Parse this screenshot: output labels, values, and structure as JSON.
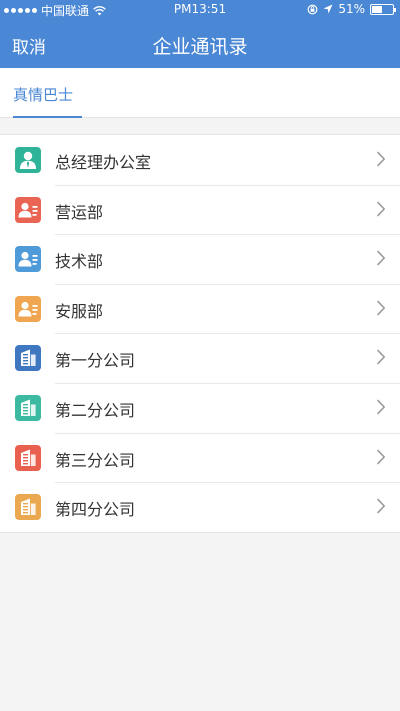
{
  "status": {
    "carrier": "中国联通",
    "time": "PM13:51",
    "battery": "51%",
    "battery_level": 0.51
  },
  "nav": {
    "cancel": "取消",
    "title": "企业通讯录"
  },
  "tabs": [
    {
      "label": "真情巴士"
    }
  ],
  "list": [
    {
      "label": "总经理办公室",
      "icon": "manager-person-icon",
      "color": "#2fb49a"
    },
    {
      "label": "营运部",
      "icon": "department-card-icon",
      "color": "#ea6454"
    },
    {
      "label": "技术部",
      "icon": "department-card-icon",
      "color": "#4f9ad9"
    },
    {
      "label": "安服部",
      "icon": "department-card-icon",
      "color": "#f0a650"
    },
    {
      "label": "第一分公司",
      "icon": "building-icon",
      "color": "#3f78c1"
    },
    {
      "label": "第二分公司",
      "icon": "building-icon",
      "color": "#3bb9a1"
    },
    {
      "label": "第三分公司",
      "icon": "building-icon",
      "color": "#e9604e"
    },
    {
      "label": "第四分公司",
      "icon": "building-icon",
      "color": "#eaa850"
    }
  ]
}
